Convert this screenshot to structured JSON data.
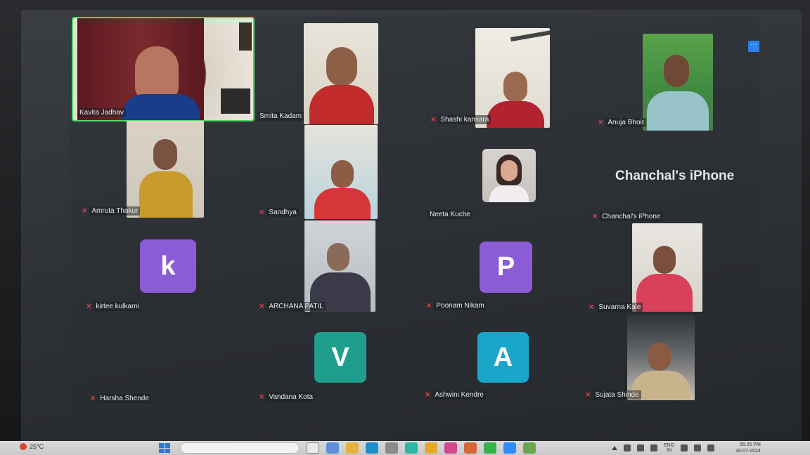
{
  "meeting": {
    "label_iphone_big": "Chanchal's iPhone",
    "participants": [
      {
        "name": "Kavita Jadhav",
        "muted": false,
        "kind": "video"
      },
      {
        "name": "Smita Kadam",
        "muted": false,
        "kind": "video"
      },
      {
        "name": "Shashi kansara",
        "muted": true,
        "kind": "video"
      },
      {
        "name": "Anuja Bhoir",
        "muted": true,
        "kind": "video"
      },
      {
        "name": "Amruta Thakur",
        "muted": true,
        "kind": "video"
      },
      {
        "name": "Sandhya",
        "muted": true,
        "kind": "video"
      },
      {
        "name": "Neeta Kuche",
        "muted": false,
        "kind": "video"
      },
      {
        "name": "Chanchal's iPhone",
        "muted": true,
        "kind": "text"
      },
      {
        "name": "kirtee kulkarni",
        "muted": true,
        "kind": "avatar",
        "initial": "k"
      },
      {
        "name": "ARCHANA PATIL",
        "muted": true,
        "kind": "video"
      },
      {
        "name": "Poonam Nikam",
        "muted": true,
        "kind": "avatar",
        "initial": "P"
      },
      {
        "name": "Suvarna Kale",
        "muted": true,
        "kind": "video"
      },
      {
        "name": "Harsha Shende",
        "muted": true,
        "kind": "none"
      },
      {
        "name": "Vandana Kota",
        "muted": true,
        "kind": "avatar",
        "initial": "V"
      },
      {
        "name": "Ashwini Kendre",
        "muted": true,
        "kind": "avatar",
        "initial": "A"
      },
      {
        "name": "Sujata Shinde",
        "muted": true,
        "kind": "video"
      }
    ],
    "more_button": "···"
  },
  "taskbar": {
    "temperature": "25°C",
    "language_top": "ENG",
    "language_bottom": "IN",
    "time": "06:25 PM",
    "date": "16-07-2024"
  },
  "colors": {
    "avatar_purple": "#8b5cd6",
    "avatar_teal": "#1f9e8e",
    "avatar_cyan": "#1aa6c9",
    "active_speaker": "#4cd964",
    "muted_icon": "#e04a4a"
  }
}
